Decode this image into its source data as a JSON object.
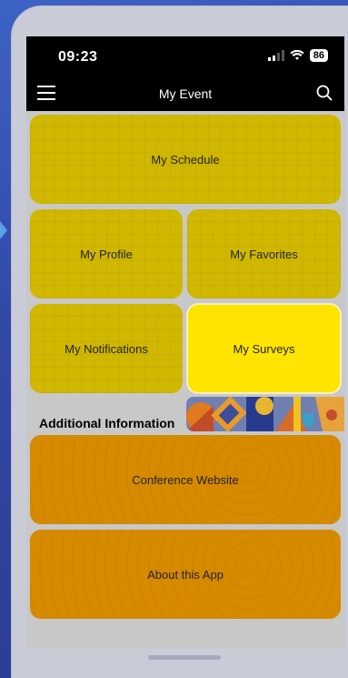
{
  "status": {
    "time": "09:23",
    "battery": "86"
  },
  "navbar": {
    "title": "My Event"
  },
  "tiles": {
    "schedule": "My Schedule",
    "profile": "My Profile",
    "favorites": "My Favorites",
    "notifications": "My Notifications",
    "surveys": "My Surveys"
  },
  "section": {
    "title": "Additional Information"
  },
  "links": {
    "website": "Conference Website",
    "about": "About this App"
  },
  "colors": {
    "tile_yellow": "#d0b700",
    "tile_active": "#ffe400",
    "tile_orange": "#d68a00"
  },
  "icons": [
    "menu-icon",
    "search-icon",
    "signal-icon",
    "wifi-icon"
  ]
}
